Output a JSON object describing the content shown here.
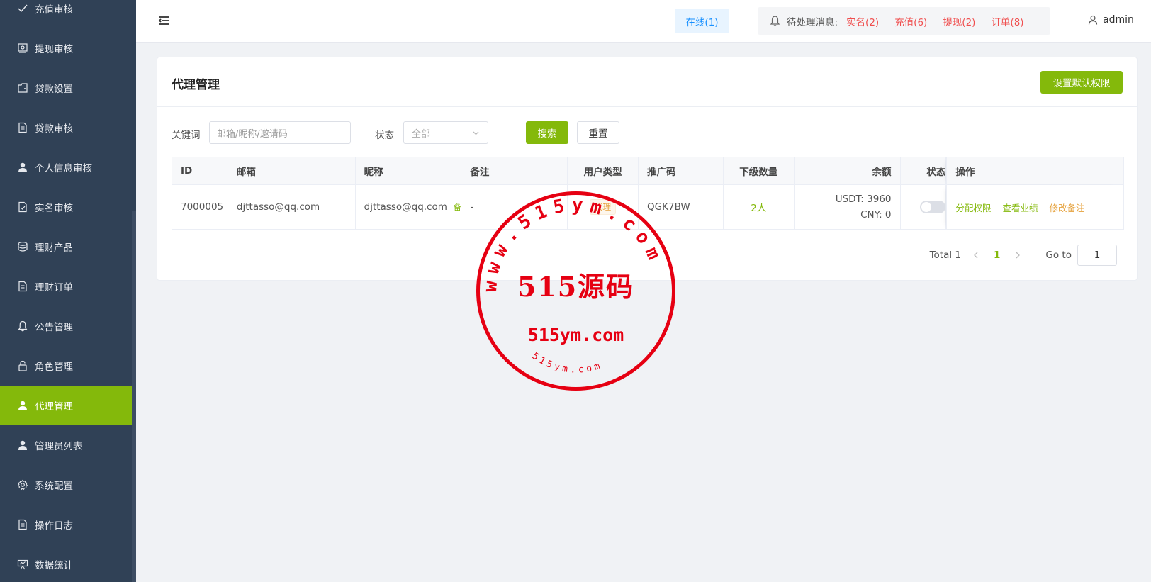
{
  "sidebar": {
    "items": [
      {
        "label": "充值审核",
        "icon": "check-icon",
        "active": false
      },
      {
        "label": "提现审核",
        "icon": "wallet-icon",
        "active": false
      },
      {
        "label": "贷款设置",
        "icon": "folder-icon",
        "active": false
      },
      {
        "label": "贷款审核",
        "icon": "document-icon",
        "active": false
      },
      {
        "label": "个人信息审核",
        "icon": "user-icon",
        "active": false
      },
      {
        "label": "实名审核",
        "icon": "document-check-icon",
        "active": false
      },
      {
        "label": "理财产品",
        "icon": "coins-icon",
        "active": false
      },
      {
        "label": "理财订单",
        "icon": "document-icon",
        "active": false
      },
      {
        "label": "公告管理",
        "icon": "bell-icon",
        "active": false
      },
      {
        "label": "角色管理",
        "icon": "lock-icon",
        "active": false
      },
      {
        "label": "代理管理",
        "icon": "user-icon",
        "active": true
      },
      {
        "label": "管理员列表",
        "icon": "user-icon",
        "active": false
      },
      {
        "label": "系统配置",
        "icon": "gear-icon",
        "active": false
      },
      {
        "label": "操作日志",
        "icon": "document-icon",
        "active": false
      },
      {
        "label": "数据统计",
        "icon": "presentation-icon",
        "active": false
      }
    ]
  },
  "header": {
    "online": "在线(1)",
    "pending_label": "待处理消息:",
    "pending_links": [
      "实名(2)",
      "充值(6)",
      "提现(2)",
      "订单(8)"
    ],
    "username": "admin"
  },
  "card": {
    "title": "代理管理",
    "default_permission_button": "设置默认权限"
  },
  "filter": {
    "keyword_label": "关键词",
    "keyword_placeholder": "邮箱/昵称/邀请码",
    "status_label": "状态",
    "status_value": "全部",
    "search_button": "搜索",
    "reset_button": "重置"
  },
  "table": {
    "headers": {
      "id": "ID",
      "email": "邮箱",
      "nickname": "昵称",
      "note": "备注",
      "user_type": "用户类型",
      "promo_code": "推广码",
      "sub_count": "下级数量",
      "balance": "余额",
      "status": "状态",
      "actions": "操作"
    },
    "rows": [
      {
        "id": "7000005",
        "email": "djttasso@qq.com",
        "nickname": "djttasso@qq.com",
        "nickname_tag": "备注",
        "note": "-",
        "user_type": "代理",
        "promo_code": "QGK7BW",
        "sub_count": "2人",
        "balance_usdt": "USDT: 3960",
        "balance_cny": "CNY: 0",
        "status_on": false,
        "actions": [
          "分配权限",
          "查看业绩",
          "修改备注"
        ]
      }
    ]
  },
  "pagination": {
    "total": "Total 1",
    "current_page": "1",
    "goto_label": "Go to",
    "goto_value": "1"
  },
  "watermark": {
    "center_text": "515源码",
    "domain_text": "515ym.com",
    "ring_text": "www.515ym.com",
    "bottom_text": "515ym.com",
    "color": "#e60012"
  },
  "colors": {
    "accent": "#84b90b",
    "sidebar_bg": "#304156",
    "danger": "#f04e4e",
    "info": "#1890ff",
    "warning": "#e6a23c"
  }
}
